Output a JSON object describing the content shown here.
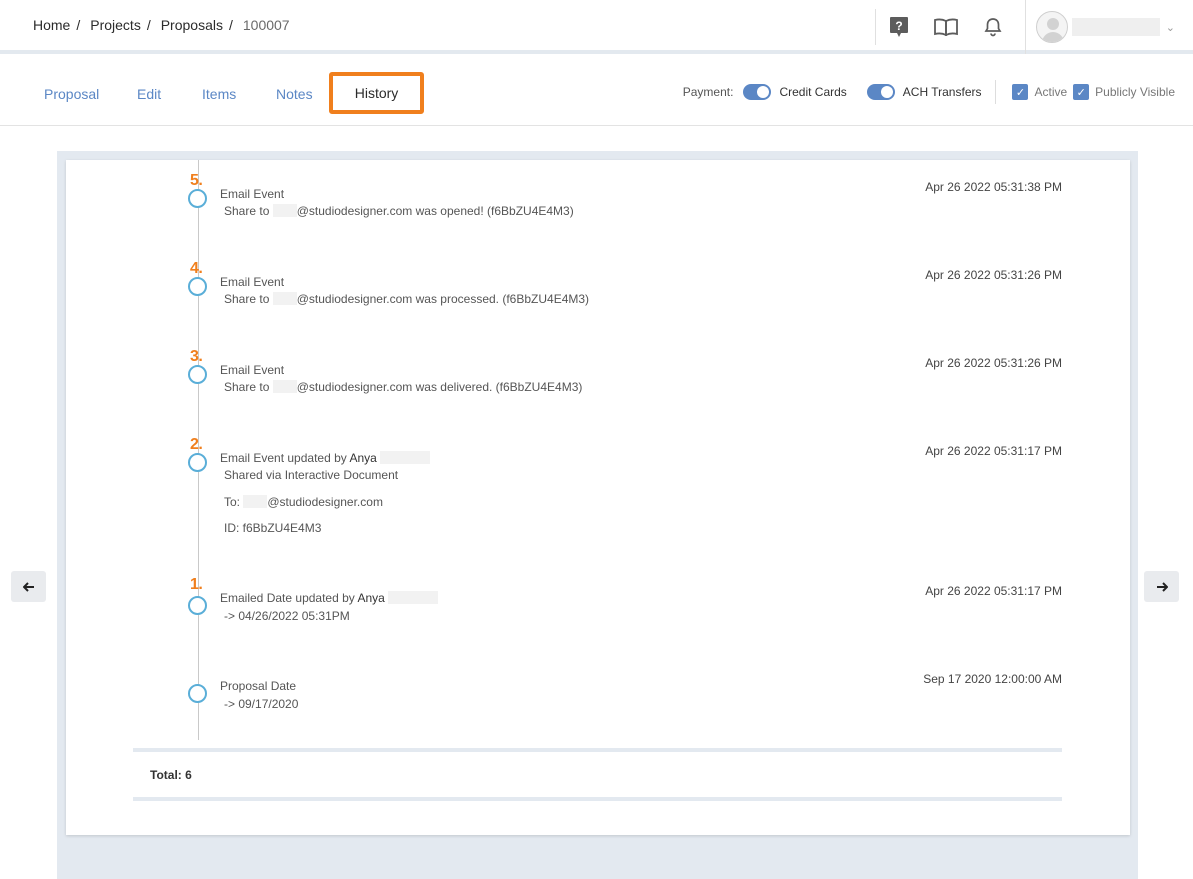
{
  "breadcrumb": {
    "items": [
      "Home",
      "Projects",
      "Proposals"
    ],
    "separator": "/",
    "current": "100007"
  },
  "header_icons": [
    "help-icon",
    "book-icon",
    "bell-icon",
    "user-avatar-icon",
    "chevron-down-icon"
  ],
  "tabs": [
    {
      "label": "Proposal"
    },
    {
      "label": "Edit"
    },
    {
      "label": "Items"
    },
    {
      "label": "Notes"
    },
    {
      "label": "History",
      "active": true
    }
  ],
  "options": {
    "payment_label": "Payment:",
    "credit_cards_label": "Credit Cards",
    "credit_cards_on": true,
    "ach_label": "ACH Transfers",
    "ach_on": true,
    "active_label": "Active",
    "active_checked": true,
    "public_label": "Publicly Visible",
    "public_checked": true
  },
  "history": [
    {
      "num": "5.",
      "title": "Email Event",
      "pre": "Share to",
      "post": "@studiodesigner.com was opened! (f6BbZU4E4M3)",
      "time": "Apr 26 2022 05:31:38 PM"
    },
    {
      "num": "4.",
      "title": "Email Event",
      "pre": "Share to",
      "post": "@studiodesigner.com was processed. (f6BbZU4E4M3)",
      "time": "Apr 26 2022 05:31:26 PM"
    },
    {
      "num": "3.",
      "title": "Email Event",
      "pre": "Share to",
      "post": "@studiodesigner.com was delivered. (f6BbZU4E4M3)",
      "time": "Apr 26 2022 05:31:26 PM"
    },
    {
      "num": "2.",
      "title": "Email Event",
      "by": "updated by",
      "name": "Anya",
      "line1": "Shared via Interactive Document",
      "to_label": "To:",
      "to_post": "@studiodesigner.com",
      "id_line": "ID: f6BbZU4E4M3",
      "time": "Apr 26 2022 05:31:17 PM"
    },
    {
      "num": "1.",
      "title": "Emailed Date",
      "by": "updated by",
      "name": "Anya",
      "line1": "-> 04/26/2022 05:31PM",
      "time": "Apr 26 2022 05:31:17 PM"
    },
    {
      "num": "",
      "title": "Proposal Date",
      "line1": "-> 09/17/2020",
      "time": "Sep 17 2020 12:00:00 AM"
    }
  ],
  "total_label": "Total: 6",
  "nav": {
    "prev_icon": "arrow-left-icon",
    "next_icon": "arrow-right-icon"
  },
  "colors": {
    "accent": "#5b87c5",
    "highlight": "#f07f1d",
    "timeline_dot": "#5aaed8"
  }
}
